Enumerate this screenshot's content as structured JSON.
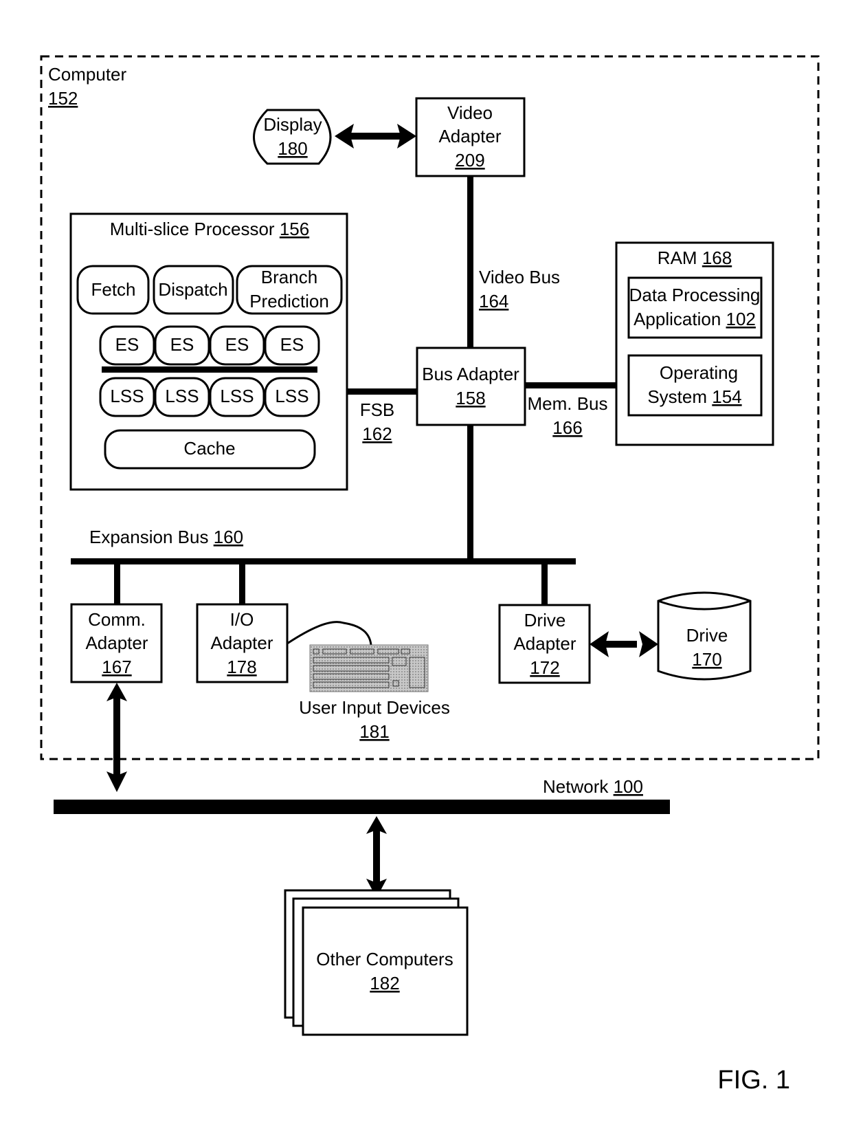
{
  "figure_label": "FIG. 1",
  "computer": {
    "label": "Computer",
    "ref": "152"
  },
  "display": {
    "label": "Display",
    "ref": "180"
  },
  "video_adapter": {
    "line1": "Video",
    "line2": "Adapter",
    "ref": "209"
  },
  "processor": {
    "label": "Multi-slice Processor",
    "ref": "156",
    "fetch": "Fetch",
    "dispatch": "Dispatch",
    "branch_line1": "Branch",
    "branch_line2": "Prediction",
    "es": [
      "ES",
      "ES",
      "ES",
      "ES"
    ],
    "lss": [
      "LSS",
      "LSS",
      "LSS",
      "LSS"
    ],
    "cache": "Cache"
  },
  "video_bus": {
    "label": "Video Bus",
    "ref": "164"
  },
  "bus_adapter": {
    "label": "Bus Adapter",
    "ref": "158"
  },
  "fsb": {
    "label": "FSB",
    "ref": "162"
  },
  "mem_bus": {
    "label": "Mem. Bus",
    "ref": "166"
  },
  "ram": {
    "label": "RAM",
    "ref": "168",
    "app_line1": "Data Processing",
    "app_line2": "Application",
    "app_ref": "102",
    "os_line1": "Operating",
    "os_line2": "System",
    "os_ref": "154"
  },
  "expansion_bus": {
    "label": "Expansion Bus",
    "ref": "160"
  },
  "comm_adapter": {
    "line1": "Comm.",
    "line2": "Adapter",
    "ref": "167"
  },
  "io_adapter": {
    "line1": "I/O",
    "line2": "Adapter",
    "ref": "178"
  },
  "user_input": {
    "label": "User Input Devices",
    "ref": "181"
  },
  "drive_adapter": {
    "line1": "Drive",
    "line2": "Adapter",
    "ref": "172"
  },
  "drive": {
    "label": "Drive",
    "ref": "170"
  },
  "network": {
    "label": "Network",
    "ref": "100"
  },
  "other_computers": {
    "label": "Other Computers",
    "ref": "182"
  }
}
